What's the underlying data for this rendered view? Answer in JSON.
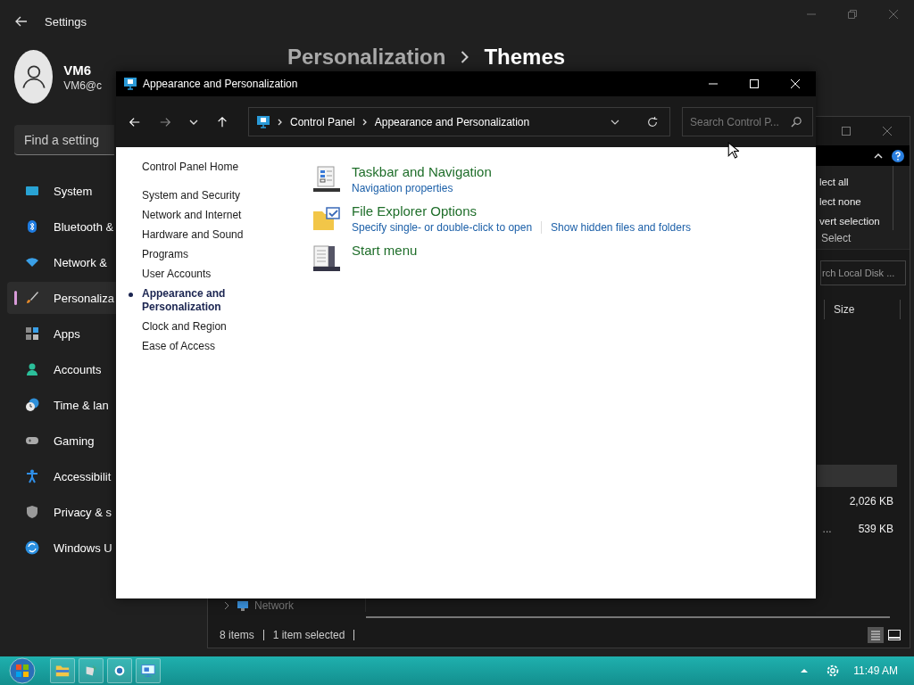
{
  "settings": {
    "title": "Settings",
    "user": {
      "name": "VM6",
      "email": "VM6@c"
    },
    "search": {
      "placeholder": "Find a setting"
    },
    "nav": [
      {
        "label": "System",
        "kind": "system",
        "selected": false
      },
      {
        "label": "Bluetooth &",
        "kind": "bluetooth",
        "selected": false
      },
      {
        "label": "Network &",
        "kind": "network",
        "selected": false
      },
      {
        "label": "Personaliza",
        "kind": "personalization",
        "selected": true
      },
      {
        "label": "Apps",
        "kind": "apps",
        "selected": false
      },
      {
        "label": "Accounts",
        "kind": "accounts",
        "selected": false
      },
      {
        "label": "Time & lan",
        "kind": "time",
        "selected": false
      },
      {
        "label": "Gaming",
        "kind": "gaming",
        "selected": false
      },
      {
        "label": "Accessibilit",
        "kind": "accessibility",
        "selected": false
      },
      {
        "label": "Privacy & s",
        "kind": "privacy",
        "selected": false
      },
      {
        "label": "Windows U",
        "kind": "update",
        "selected": false
      }
    ],
    "breadcrumb": [
      "Personalization",
      "Themes"
    ]
  },
  "explorer": {
    "ribbon_commands": [
      "lect all",
      "lect none",
      "vert selection"
    ],
    "ribbon_group": "Select",
    "search": {
      "placeholder": "rch Local Disk ..."
    },
    "columns": [
      "Size"
    ],
    "rows": [
      {
        "selected": true
      },
      {
        "size": "2,026 KB",
        "selected": false
      },
      {
        "name": "...",
        "size": "539 KB",
        "selected": false
      }
    ],
    "nav": [
      {
        "label": "Network"
      }
    ],
    "status": [
      "8 items",
      "1 item selected"
    ]
  },
  "control_panel": {
    "title": "Appearance and Personalization",
    "address": [
      "Control Panel",
      "Appearance and Personalization"
    ],
    "search": {
      "placeholder": "Search Control P..."
    },
    "home": "Control Panel Home",
    "categories": [
      {
        "label": "System and Security",
        "selected": false
      },
      {
        "label": "Network and Internet",
        "selected": false
      },
      {
        "label": "Hardware and Sound",
        "selected": false
      },
      {
        "label": "Programs",
        "selected": false
      },
      {
        "label": "User Accounts",
        "selected": false
      },
      {
        "label": "Appearance and Personalization",
        "selected": true
      },
      {
        "label": "Clock and Region",
        "selected": false
      },
      {
        "label": "Ease of Access",
        "selected": false
      }
    ],
    "sections": [
      {
        "title": "Taskbar and Navigation",
        "kind": "taskbar",
        "links": [
          "Navigation properties"
        ]
      },
      {
        "title": "File Explorer Options",
        "kind": "folder",
        "links": [
          "Specify single- or double-click to open",
          "Show hidden files and folders"
        ]
      },
      {
        "title": "Start menu",
        "kind": "startmenu"
      }
    ]
  },
  "taskbar": {
    "apps": [
      {
        "kind": "folder"
      },
      {
        "kind": "tool"
      },
      {
        "kind": "circle"
      },
      {
        "kind": "controlpanel"
      }
    ],
    "clock": "11:49 AM"
  }
}
